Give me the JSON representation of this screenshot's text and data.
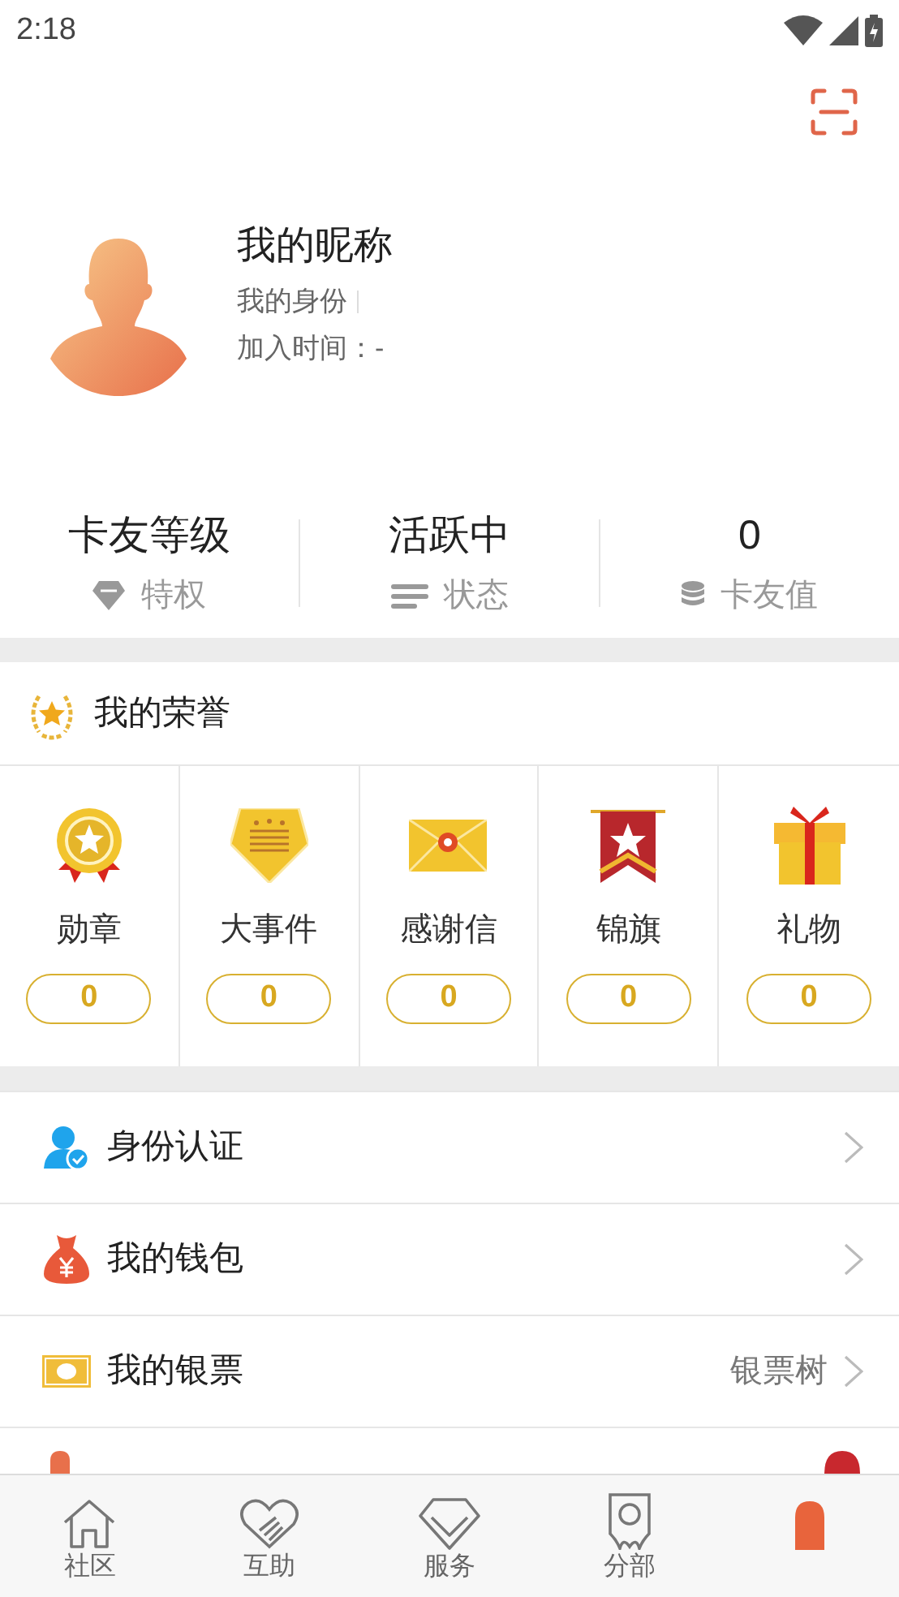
{
  "status_bar": {
    "time": "2:18"
  },
  "profile": {
    "nickname": "我的昵称",
    "identity": "我的身份",
    "join_time": "加入时间：-"
  },
  "stats": [
    {
      "value": "卡友等级",
      "kind": "diamond",
      "label": "特权"
    },
    {
      "value": "活跃中",
      "kind": "lines",
      "label": "状态"
    },
    {
      "value": "0",
      "kind": "coins",
      "label": "卡友值"
    }
  ],
  "honors": {
    "title": "我的荣誉",
    "items": [
      {
        "kind": "medal",
        "label": "勋章",
        "count": "0"
      },
      {
        "kind": "plaque",
        "label": "大事件",
        "count": "0"
      },
      {
        "kind": "letter",
        "label": "感谢信",
        "count": "0"
      },
      {
        "kind": "banner",
        "label": "锦旗",
        "count": "0"
      },
      {
        "kind": "gift",
        "label": "礼物",
        "count": "0"
      }
    ]
  },
  "menu": [
    {
      "kind": "verify",
      "label": "身份认证"
    },
    {
      "kind": "wallet",
      "label": "我的钱包"
    },
    {
      "kind": "ticket",
      "label": "我的银票",
      "detail": "银票树"
    },
    {
      "kind": "cut"
    }
  ],
  "tabs": [
    {
      "kind": "home",
      "label": "社区",
      "selected": false
    },
    {
      "kind": "heart",
      "label": "互助",
      "selected": false
    },
    {
      "kind": "gem",
      "label": "服务",
      "selected": false
    },
    {
      "kind": "branch",
      "label": "分部",
      "selected": false
    },
    {
      "kind": "me",
      "selected": true
    }
  ]
}
